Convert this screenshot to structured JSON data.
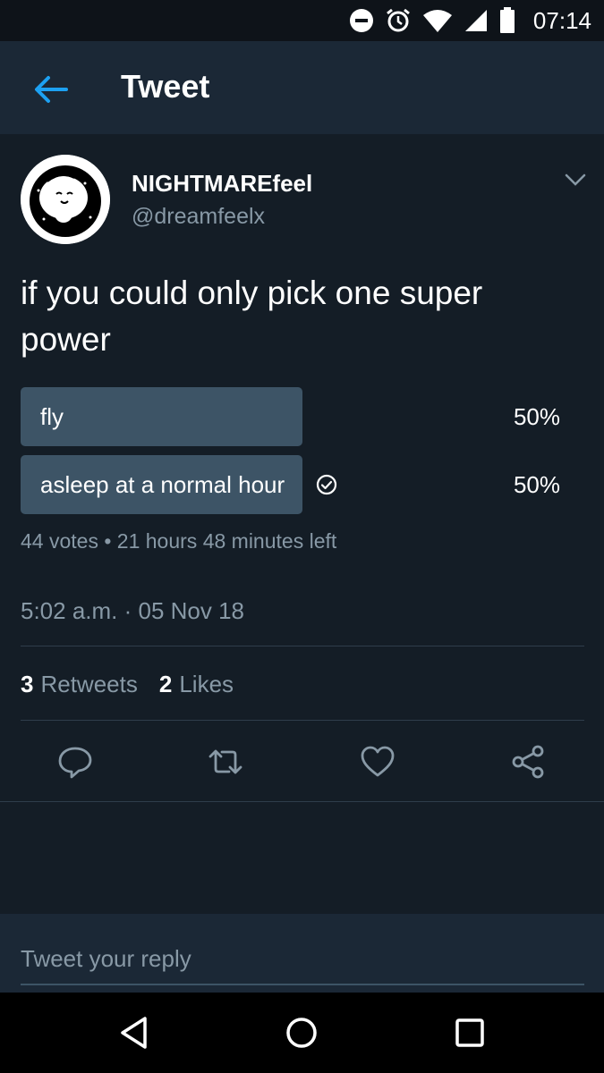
{
  "status_bar": {
    "time": "07:14"
  },
  "app_bar": {
    "title": "Tweet"
  },
  "tweet": {
    "author_name": "NIGHTMAREfeel",
    "author_handle": "@dreamfeelx",
    "text": "if you could only pick one super power",
    "poll": {
      "options": [
        {
          "label": "fly",
          "percent": "50%",
          "fill_fraction": 0.5,
          "selected": false
        },
        {
          "label": "asleep at a normal hour",
          "percent": "50%",
          "fill_fraction": 0.5,
          "selected": true
        }
      ],
      "votes": "44 votes",
      "separator": "•",
      "time_left": "21 hours 48 minutes left"
    },
    "timestamp": "5:02 a.m. · 05 Nov 18",
    "stats": {
      "retweets_count": "3",
      "retweets_label": "Retweets",
      "likes_count": "2",
      "likes_label": "Likes"
    }
  },
  "reply": {
    "placeholder": "Tweet your reply"
  },
  "icons": {
    "back": "arrow-left-icon",
    "caret": "chevron-down-icon",
    "reply": "speech-bubble-icon",
    "retweet": "retweet-icon",
    "like": "heart-icon",
    "share": "share-icon",
    "check": "check-circle-icon"
  },
  "colors": {
    "background": "#141d26",
    "bar": "#1b2836",
    "accent": "#1da1f2",
    "poll_fill": "#3d5466",
    "muted": "#8899a6"
  }
}
